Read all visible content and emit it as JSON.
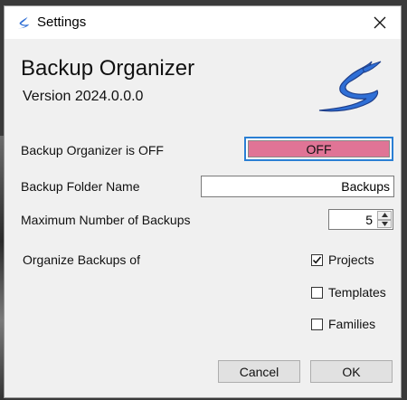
{
  "window": {
    "title": "Settings",
    "close_icon": "close-icon",
    "app_icon": "organizer-logo-icon"
  },
  "header": {
    "app_name": "Backup Organizer",
    "version": "Version 2024.0.0.0"
  },
  "settings": {
    "status_label": "Backup Organizer is OFF",
    "toggle_label": "OFF",
    "toggle_color": "#e07496",
    "folder_label": "Backup Folder Name",
    "folder_value": "Backups",
    "max_label": "Maximum Number of Backups",
    "max_value": "5",
    "organize_label": "Organize Backups of",
    "options": [
      {
        "label": "Projects",
        "checked": true
      },
      {
        "label": "Templates",
        "checked": false
      },
      {
        "label": "Families",
        "checked": false
      }
    ]
  },
  "footer": {
    "cancel_label": "Cancel",
    "ok_label": "OK"
  },
  "colors": {
    "accent": "#2a7fd4",
    "logo_blue": "#2f6fd6"
  }
}
